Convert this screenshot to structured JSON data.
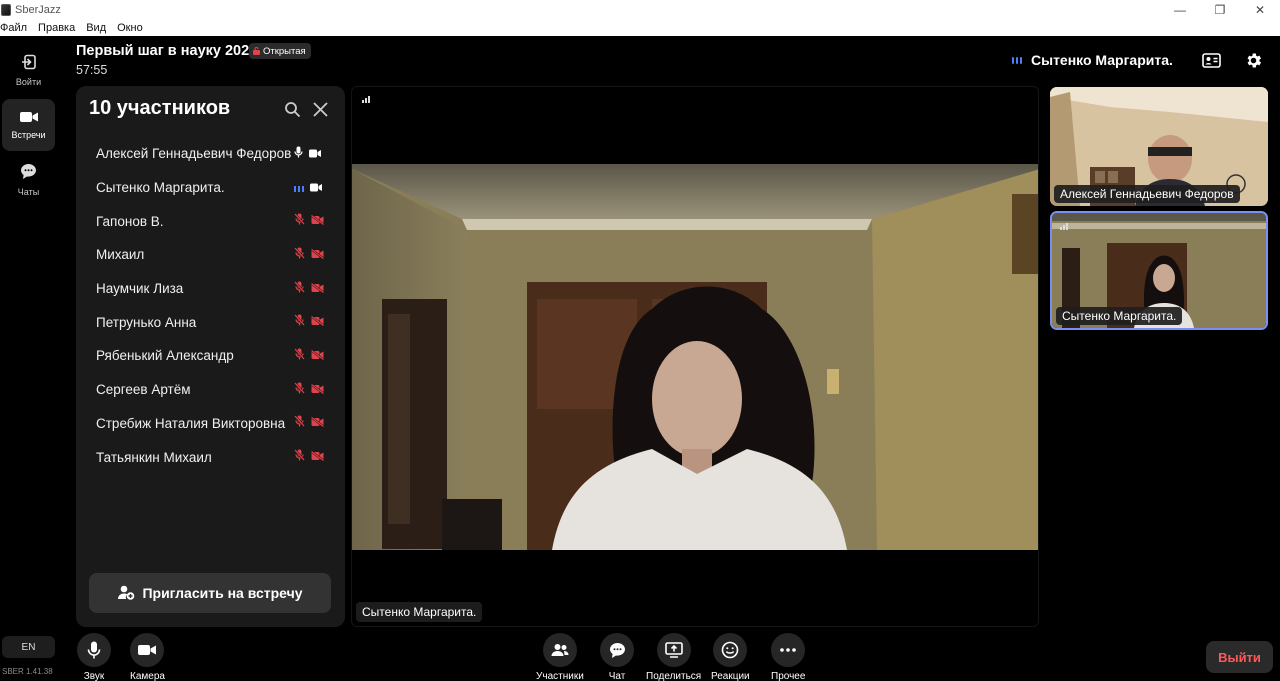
{
  "window": {
    "title": "SberJazz",
    "controls": [
      "—",
      "❐",
      "✕"
    ]
  },
  "menu": [
    "Файл",
    "Правка",
    "Вид",
    "Окно"
  ],
  "rail": {
    "items": [
      {
        "label": "Войти",
        "icon": "login-icon"
      },
      {
        "label": "Встречи",
        "icon": "video-camera-icon",
        "active": true
      },
      {
        "label": "Чаты",
        "icon": "chat-bubble-icon"
      }
    ],
    "language": "EN",
    "version": "SBER 1.41.38"
  },
  "header": {
    "meeting_title": "Первый шаг в науку 2024",
    "badge": "Открытая",
    "timer": "57:55",
    "active_speaker": "Сытенко Маргарита."
  },
  "participants_panel": {
    "title": "10 участников",
    "participants": [
      {
        "name": "Алексей Геннадьевич Федоров",
        "mic": "on",
        "camera": "on"
      },
      {
        "name": "Сытенко Маргарита.",
        "mic": "speaking",
        "camera": "on"
      },
      {
        "name": "Гапонов В.",
        "mic": "off",
        "camera": "off"
      },
      {
        "name": "Михаил",
        "mic": "off",
        "camera": "off"
      },
      {
        "name": "Наумчик Лиза",
        "mic": "off",
        "camera": "off"
      },
      {
        "name": "Петрунько Анна",
        "mic": "off",
        "camera": "off"
      },
      {
        "name": "Рябенький Александр",
        "mic": "off",
        "camera": "off"
      },
      {
        "name": "Сергеев Артём",
        "mic": "off",
        "camera": "off"
      },
      {
        "name": "Стребиж Наталия Викторовна",
        "mic": "off",
        "camera": "off"
      },
      {
        "name": "Татьянкин Михаил",
        "mic": "off",
        "camera": "off"
      }
    ],
    "invite_label": "Пригласить на встречу"
  },
  "main_video": {
    "name": "Сытенко Маргарита."
  },
  "thumbnails": [
    {
      "name": "Алексей Геннадьевич Федоров"
    },
    {
      "name": "Сытенко Маргарита."
    }
  ],
  "toolbar": {
    "left": [
      {
        "label": "Звук",
        "icon": "microphone-icon"
      },
      {
        "label": "Камера",
        "icon": "camera-icon"
      }
    ],
    "center": [
      {
        "label": "Участники",
        "icon": "participants-icon"
      },
      {
        "label": "Чат",
        "icon": "chat-icon"
      },
      {
        "label": "Поделиться",
        "icon": "share-screen-icon"
      },
      {
        "label": "Реакции",
        "icon": "smiley-icon"
      },
      {
        "label": "Прочее",
        "icon": "more-icon"
      }
    ],
    "leave_label": "Выйти"
  },
  "colors": {
    "accent_blue": "#4d7cff",
    "muted_red": "#e0434b",
    "leave_red": "#ff5a5a",
    "panel_bg": "#1a1a1a"
  }
}
